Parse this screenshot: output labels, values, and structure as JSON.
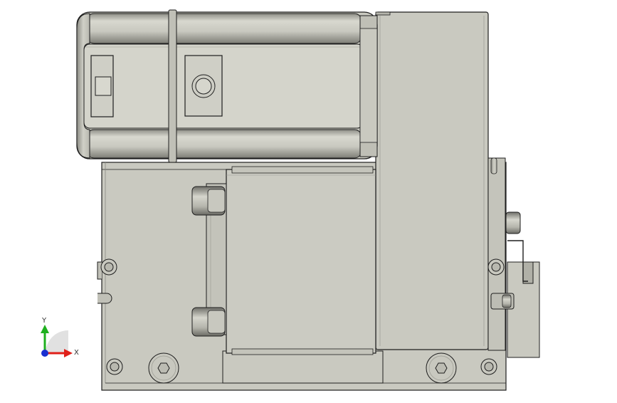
{
  "triad": {
    "x_label": "X",
    "y_label": "Y",
    "x_color": "#e0201a",
    "y_color": "#1fb01f",
    "z_color": "#1a2fd0"
  },
  "colors": {
    "part_fill": "#c9c9c0",
    "part_light": "#d4d4cb",
    "part_dark": "#aeaea5",
    "edge": "#1e1e1e"
  }
}
